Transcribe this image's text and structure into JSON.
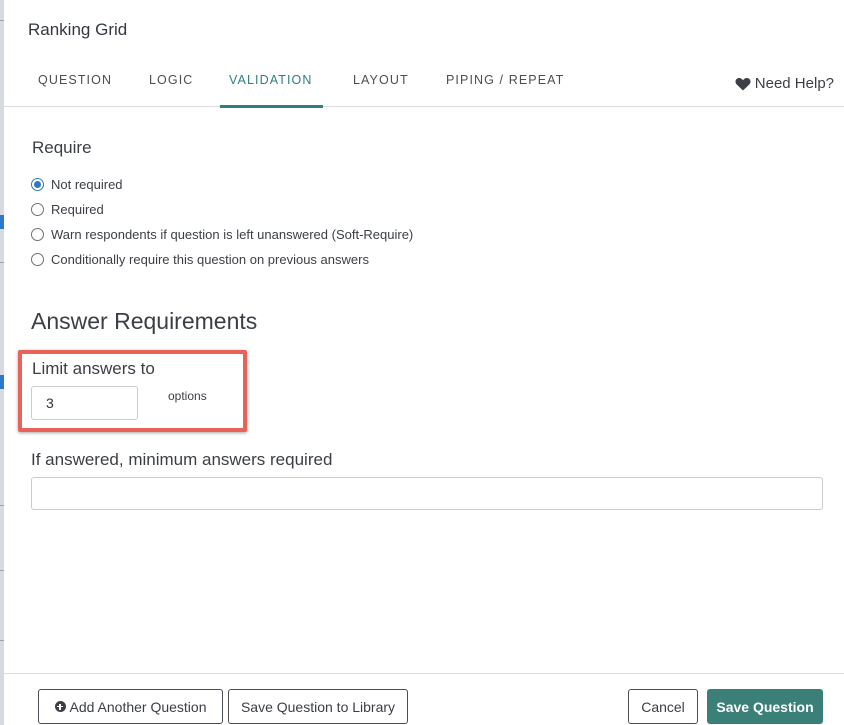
{
  "modal": {
    "title": "Ranking Grid"
  },
  "tabs": [
    {
      "label": "QUESTION"
    },
    {
      "label": "LOGIC"
    },
    {
      "label": "VALIDATION"
    },
    {
      "label": "LAYOUT"
    },
    {
      "label": "PIPING / REPEAT"
    }
  ],
  "active_tab": "VALIDATION",
  "help": {
    "label": "Need Help?",
    "icon": "heart-icon"
  },
  "require": {
    "label": "Require",
    "options": [
      {
        "label": "Not required",
        "checked": true
      },
      {
        "label": "Required",
        "checked": false
      },
      {
        "label": "Warn respondents if question is left unanswered (Soft-Require)",
        "checked": false
      },
      {
        "label": "Conditionally require this question on previous answers",
        "checked": false
      }
    ]
  },
  "answer_requirements": {
    "title": "Answer Requirements",
    "limit_label": "Limit answers to",
    "limit_value": "3",
    "limit_suffix": "options",
    "min_label": "If answered, minimum answers required",
    "min_value": ""
  },
  "footer": {
    "add_another": "Add Another Question",
    "save_library": "Save Question to Library",
    "cancel": "Cancel",
    "save": "Save Question"
  },
  "colors": {
    "accent": "#2f7f7a",
    "primary_button": "#3a7f78",
    "highlight": "#e8625a",
    "radio_checked": "#2f78c4"
  }
}
